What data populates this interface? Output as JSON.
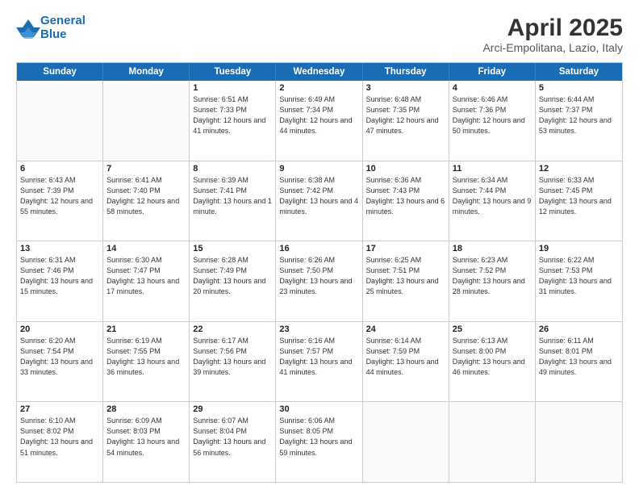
{
  "logo": {
    "line1": "General",
    "line2": "Blue"
  },
  "title": "April 2025",
  "subtitle": "Arci-Empolitana, Lazio, Italy",
  "days": [
    "Sunday",
    "Monday",
    "Tuesday",
    "Wednesday",
    "Thursday",
    "Friday",
    "Saturday"
  ],
  "weeks": [
    [
      {
        "date": "",
        "sunrise": "",
        "sunset": "",
        "daylight": ""
      },
      {
        "date": "",
        "sunrise": "",
        "sunset": "",
        "daylight": ""
      },
      {
        "date": "1",
        "sunrise": "Sunrise: 6:51 AM",
        "sunset": "Sunset: 7:33 PM",
        "daylight": "Daylight: 12 hours and 41 minutes."
      },
      {
        "date": "2",
        "sunrise": "Sunrise: 6:49 AM",
        "sunset": "Sunset: 7:34 PM",
        "daylight": "Daylight: 12 hours and 44 minutes."
      },
      {
        "date": "3",
        "sunrise": "Sunrise: 6:48 AM",
        "sunset": "Sunset: 7:35 PM",
        "daylight": "Daylight: 12 hours and 47 minutes."
      },
      {
        "date": "4",
        "sunrise": "Sunrise: 6:46 AM",
        "sunset": "Sunset: 7:36 PM",
        "daylight": "Daylight: 12 hours and 50 minutes."
      },
      {
        "date": "5",
        "sunrise": "Sunrise: 6:44 AM",
        "sunset": "Sunset: 7:37 PM",
        "daylight": "Daylight: 12 hours and 53 minutes."
      }
    ],
    [
      {
        "date": "6",
        "sunrise": "Sunrise: 6:43 AM",
        "sunset": "Sunset: 7:39 PM",
        "daylight": "Daylight: 12 hours and 55 minutes."
      },
      {
        "date": "7",
        "sunrise": "Sunrise: 6:41 AM",
        "sunset": "Sunset: 7:40 PM",
        "daylight": "Daylight: 12 hours and 58 minutes."
      },
      {
        "date": "8",
        "sunrise": "Sunrise: 6:39 AM",
        "sunset": "Sunset: 7:41 PM",
        "daylight": "Daylight: 13 hours and 1 minute."
      },
      {
        "date": "9",
        "sunrise": "Sunrise: 6:38 AM",
        "sunset": "Sunset: 7:42 PM",
        "daylight": "Daylight: 13 hours and 4 minutes."
      },
      {
        "date": "10",
        "sunrise": "Sunrise: 6:36 AM",
        "sunset": "Sunset: 7:43 PM",
        "daylight": "Daylight: 13 hours and 6 minutes."
      },
      {
        "date": "11",
        "sunrise": "Sunrise: 6:34 AM",
        "sunset": "Sunset: 7:44 PM",
        "daylight": "Daylight: 13 hours and 9 minutes."
      },
      {
        "date": "12",
        "sunrise": "Sunrise: 6:33 AM",
        "sunset": "Sunset: 7:45 PM",
        "daylight": "Daylight: 13 hours and 12 minutes."
      }
    ],
    [
      {
        "date": "13",
        "sunrise": "Sunrise: 6:31 AM",
        "sunset": "Sunset: 7:46 PM",
        "daylight": "Daylight: 13 hours and 15 minutes."
      },
      {
        "date": "14",
        "sunrise": "Sunrise: 6:30 AM",
        "sunset": "Sunset: 7:47 PM",
        "daylight": "Daylight: 13 hours and 17 minutes."
      },
      {
        "date": "15",
        "sunrise": "Sunrise: 6:28 AM",
        "sunset": "Sunset: 7:49 PM",
        "daylight": "Daylight: 13 hours and 20 minutes."
      },
      {
        "date": "16",
        "sunrise": "Sunrise: 6:26 AM",
        "sunset": "Sunset: 7:50 PM",
        "daylight": "Daylight: 13 hours and 23 minutes."
      },
      {
        "date": "17",
        "sunrise": "Sunrise: 6:25 AM",
        "sunset": "Sunset: 7:51 PM",
        "daylight": "Daylight: 13 hours and 25 minutes."
      },
      {
        "date": "18",
        "sunrise": "Sunrise: 6:23 AM",
        "sunset": "Sunset: 7:52 PM",
        "daylight": "Daylight: 13 hours and 28 minutes."
      },
      {
        "date": "19",
        "sunrise": "Sunrise: 6:22 AM",
        "sunset": "Sunset: 7:53 PM",
        "daylight": "Daylight: 13 hours and 31 minutes."
      }
    ],
    [
      {
        "date": "20",
        "sunrise": "Sunrise: 6:20 AM",
        "sunset": "Sunset: 7:54 PM",
        "daylight": "Daylight: 13 hours and 33 minutes."
      },
      {
        "date": "21",
        "sunrise": "Sunrise: 6:19 AM",
        "sunset": "Sunset: 7:55 PM",
        "daylight": "Daylight: 13 hours and 36 minutes."
      },
      {
        "date": "22",
        "sunrise": "Sunrise: 6:17 AM",
        "sunset": "Sunset: 7:56 PM",
        "daylight": "Daylight: 13 hours and 39 minutes."
      },
      {
        "date": "23",
        "sunrise": "Sunrise: 6:16 AM",
        "sunset": "Sunset: 7:57 PM",
        "daylight": "Daylight: 13 hours and 41 minutes."
      },
      {
        "date": "24",
        "sunrise": "Sunrise: 6:14 AM",
        "sunset": "Sunset: 7:59 PM",
        "daylight": "Daylight: 13 hours and 44 minutes."
      },
      {
        "date": "25",
        "sunrise": "Sunrise: 6:13 AM",
        "sunset": "Sunset: 8:00 PM",
        "daylight": "Daylight: 13 hours and 46 minutes."
      },
      {
        "date": "26",
        "sunrise": "Sunrise: 6:11 AM",
        "sunset": "Sunset: 8:01 PM",
        "daylight": "Daylight: 13 hours and 49 minutes."
      }
    ],
    [
      {
        "date": "27",
        "sunrise": "Sunrise: 6:10 AM",
        "sunset": "Sunset: 8:02 PM",
        "daylight": "Daylight: 13 hours and 51 minutes."
      },
      {
        "date": "28",
        "sunrise": "Sunrise: 6:09 AM",
        "sunset": "Sunset: 8:03 PM",
        "daylight": "Daylight: 13 hours and 54 minutes."
      },
      {
        "date": "29",
        "sunrise": "Sunrise: 6:07 AM",
        "sunset": "Sunset: 8:04 PM",
        "daylight": "Daylight: 13 hours and 56 minutes."
      },
      {
        "date": "30",
        "sunrise": "Sunrise: 6:06 AM",
        "sunset": "Sunset: 8:05 PM",
        "daylight": "Daylight: 13 hours and 59 minutes."
      },
      {
        "date": "",
        "sunrise": "",
        "sunset": "",
        "daylight": ""
      },
      {
        "date": "",
        "sunrise": "",
        "sunset": "",
        "daylight": ""
      },
      {
        "date": "",
        "sunrise": "",
        "sunset": "",
        "daylight": ""
      }
    ]
  ]
}
